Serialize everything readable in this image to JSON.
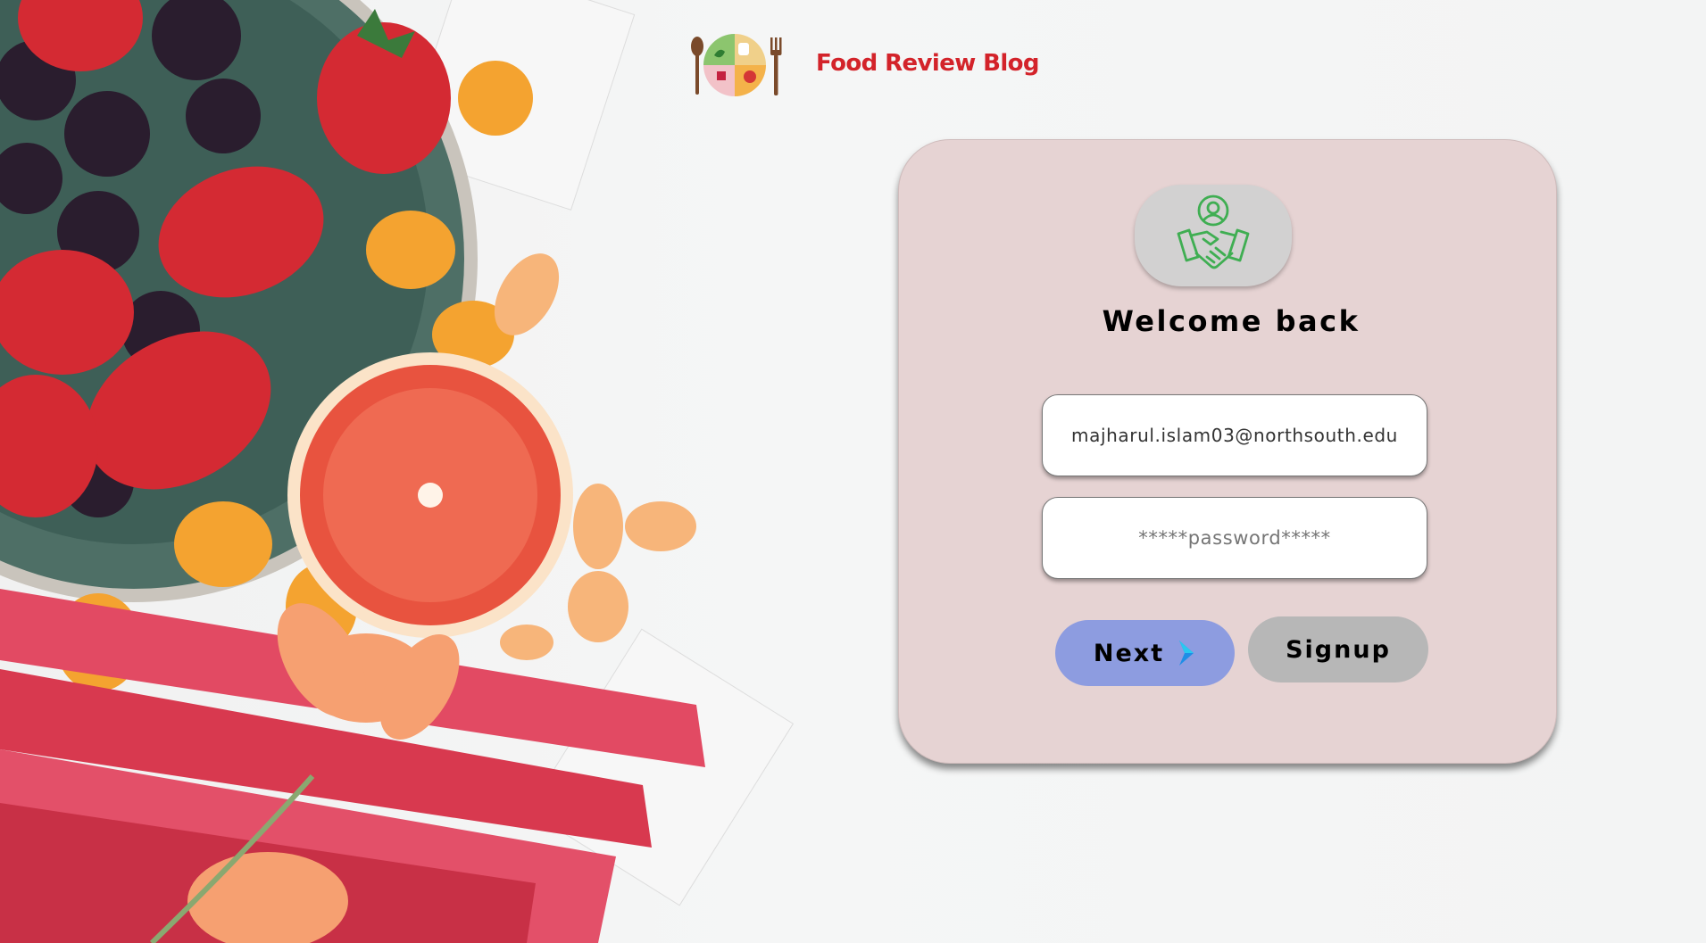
{
  "header": {
    "brand_title": "Food Review Blog",
    "logo_icon": "plate-with-fork-and-spoon-icon",
    "brand_color": "#d3232a"
  },
  "login": {
    "avatar_icon": "handshake-user-icon",
    "welcome_text": "Welcome back",
    "email_value": "majharul.islam03@northsouth.edu",
    "password_placeholder": "*****password*****",
    "next_label": "Next",
    "next_icon": "chevron-right-icon",
    "signup_label": "Signup",
    "colors": {
      "card_bg": "#e6d3d3",
      "next_bg": "#8d9ce0",
      "signup_bg": "#b7b7b7",
      "icon_green": "#3fae52"
    }
  }
}
